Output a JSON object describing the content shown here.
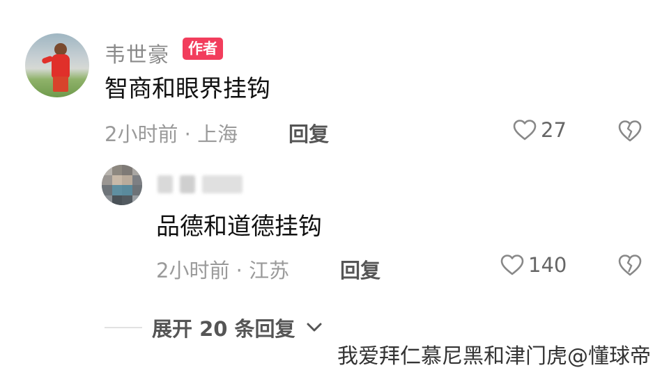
{
  "comment": {
    "username": "韦世豪",
    "badge": "作者",
    "text": "智商和眼界挂钩",
    "meta": "2小时前 · 上海",
    "reply_label": "回复",
    "likes": "27"
  },
  "reply": {
    "text": "品德和道德挂钩",
    "meta": "2小时前 · 江苏",
    "reply_label": "回复",
    "likes": "140"
  },
  "expand": {
    "label": "展开 20 条回复"
  },
  "watermark": "我爱拜仁慕尼黑和津门虎@懂球帝",
  "colors": {
    "badge": "#f23d5c",
    "meta": "#9a9a9a"
  },
  "icons": [
    "heart-outline-icon",
    "broken-heart-icon",
    "chevron-down-icon"
  ]
}
